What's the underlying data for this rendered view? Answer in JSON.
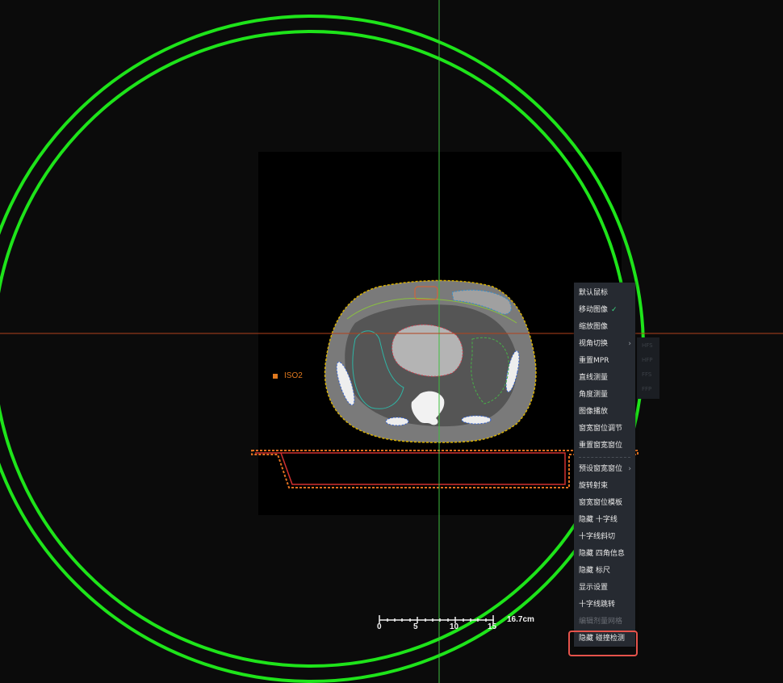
{
  "viewer": {
    "iso_label": "ISO2",
    "ruler": {
      "ticks": [
        "0",
        "5",
        "10",
        "15"
      ],
      "scale_label": "16.7cm"
    }
  },
  "context_menu": {
    "items": [
      {
        "label": "默认鼠标"
      },
      {
        "label": "移动图像",
        "checked": "✓"
      },
      {
        "label": "缩放图像"
      },
      {
        "label": "视角切换",
        "submenu": "›"
      },
      {
        "label": "重置MPR"
      },
      {
        "label": "直线测量"
      },
      {
        "label": "角度测量"
      },
      {
        "label": "图像播放"
      },
      {
        "label": "窗宽窗位调节"
      },
      {
        "label": "重置窗宽窗位"
      },
      {
        "label": "预设窗宽窗位",
        "submenu": "›"
      },
      {
        "label": "旋转射束"
      },
      {
        "label": "窗宽窗位模板"
      },
      {
        "label": "隐藏 十字线"
      },
      {
        "label": "十字线斜切"
      },
      {
        "label": "隐藏 四角信息"
      },
      {
        "label": "隐藏 标尺"
      },
      {
        "label": "显示设置"
      },
      {
        "label": "十字线跳转"
      },
      {
        "label": "编辑剂量网格",
        "disabled": true
      },
      {
        "label": "隐藏 碰撞检测"
      }
    ],
    "view_submenu": [
      "HFS",
      "HFP",
      "FFS",
      "FFP"
    ]
  },
  "colors": {
    "ring": "#1ee41a",
    "crosshair_vertical": "#3fbf3f",
    "crosshair_horizontal": "#b2421c",
    "iso": "#e0791f",
    "highlight_box": "#e5534b"
  }
}
